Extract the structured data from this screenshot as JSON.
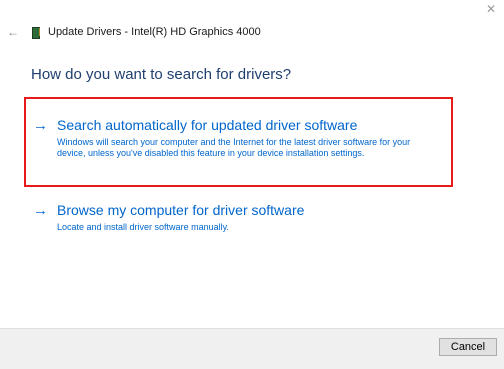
{
  "window": {
    "close_glyph": "✕",
    "back_glyph": "←",
    "title": "Update Drivers - Intel(R) HD Graphics 4000"
  },
  "main": {
    "question": "How do you want to search for drivers?",
    "options": [
      {
        "title": "Search automatically for updated driver software",
        "description": "Windows will search your computer and the Internet for the latest driver software for your device, unless you've disabled this feature in your device installation settings.",
        "highlighted": true
      },
      {
        "title": "Browse my computer for driver software",
        "description": "Locate and install driver software manually.",
        "highlighted": false
      }
    ],
    "arrow_glyph": "→"
  },
  "footer": {
    "cancel_label": "Cancel"
  },
  "colors": {
    "link": "#0066cc",
    "heading": "#1f3f6e",
    "highlight": "#e81b1b"
  }
}
